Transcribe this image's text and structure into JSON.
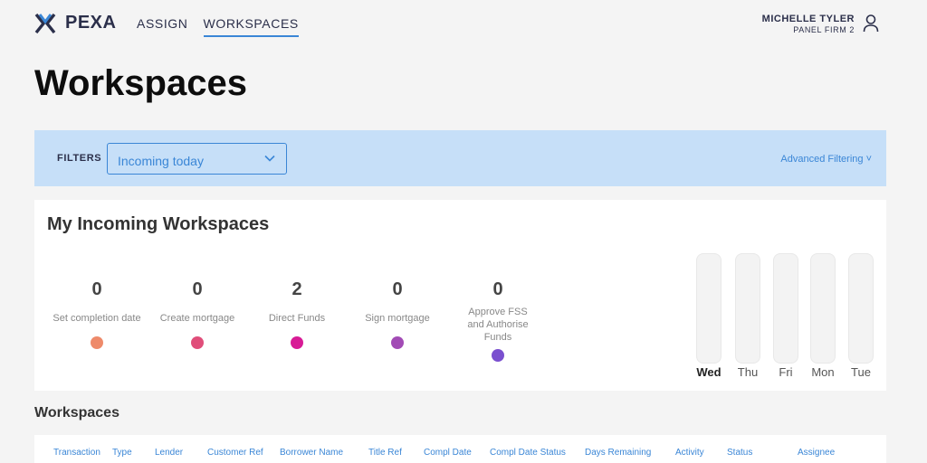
{
  "brand": {
    "name": "PEXA"
  },
  "nav": {
    "items": [
      {
        "label": "ASSIGN"
      },
      {
        "label": "WORKSPACES"
      }
    ]
  },
  "user": {
    "name": "MICHELLE TYLER",
    "firm": "PANEL FIRM 2"
  },
  "page": {
    "title": "Workspaces"
  },
  "filters": {
    "label": "FILTERS",
    "selected": "Incoming today",
    "advanced_label": "Advanced Filtering"
  },
  "incoming": {
    "title": "My Incoming Workspaces",
    "stats": [
      {
        "count": "0",
        "label": "Set completion date",
        "color": "#ee8a6a"
      },
      {
        "count": "0",
        "label": "Create mortgage",
        "color": "#e04e7a"
      },
      {
        "count": "2",
        "label": "Direct Funds",
        "color": "#d81b96"
      },
      {
        "count": "0",
        "label": "Sign mortgage",
        "color": "#a24bb5"
      },
      {
        "count": "0",
        "label": "Approve FSS and Authorise Funds",
        "color": "#7a4fcf"
      }
    ],
    "days": [
      {
        "label": "Wed"
      },
      {
        "label": "Thu"
      },
      {
        "label": "Fri"
      },
      {
        "label": "Mon"
      },
      {
        "label": "Tue"
      }
    ]
  },
  "workspaces": {
    "title": "Workspaces",
    "columns": [
      "Transaction",
      "Type",
      "Lender",
      "Customer Ref",
      "Borrower Name",
      "Title Ref",
      "Compl Date",
      "Compl Date Status",
      "Days Remaining",
      "Activity",
      "Status",
      "Assignee"
    ]
  },
  "colors": {
    "accent": "#3a86d6",
    "filter_bg": "#c6dff8",
    "brand_dark": "#2b2f4a"
  },
  "icons": {
    "logo": "pexa-x-logo",
    "user": "user-icon",
    "chevron": "chevron-down-icon"
  }
}
